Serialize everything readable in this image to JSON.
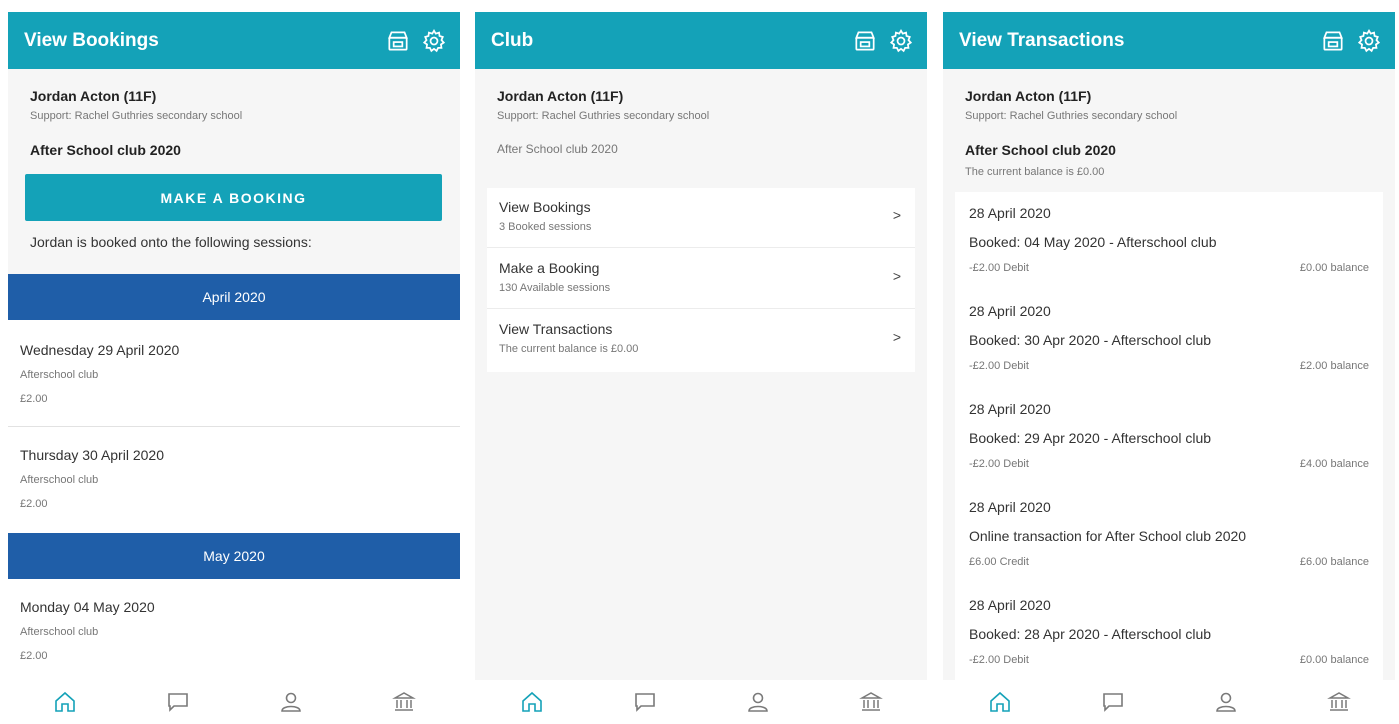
{
  "colors": {
    "header": "#14a2b8",
    "month_bar": "#1f5ea8",
    "button": "#14a2b8",
    "active_tab": "#14a2b8",
    "inactive_tab": "#7a7a7a"
  },
  "student": {
    "name": "Jordan Acton (11F)",
    "support": "Support: Rachel Guthries secondary school"
  },
  "club_name": "After School club 2020",
  "tabs": [
    "home-icon",
    "message-icon",
    "profile-icon",
    "bank-icon"
  ],
  "bookings_screen": {
    "title": "View Bookings",
    "button_label": "MAKE A BOOKING",
    "intro": "Jordan is booked onto the following sessions:",
    "months": [
      {
        "label": "April 2020",
        "sessions": [
          {
            "date": "Wednesday 29 April 2020",
            "name": "Afterschool club",
            "price": "£2.00"
          },
          {
            "date": "Thursday 30 April 2020",
            "name": "Afterschool club",
            "price": "£2.00"
          }
        ]
      },
      {
        "label": "May 2020",
        "sessions": [
          {
            "date": "Monday 04 May 2020",
            "name": "Afterschool club",
            "price": "£2.00"
          }
        ]
      }
    ]
  },
  "club_screen": {
    "title": "Club",
    "menu": [
      {
        "title": "View Bookings",
        "sub": "3 Booked sessions",
        "arrow": ">"
      },
      {
        "title": "Make a Booking",
        "sub": "130 Available sessions",
        "arrow": ">"
      },
      {
        "title": "View Transactions",
        "sub": "The current balance is £0.00",
        "arrow": ">"
      }
    ]
  },
  "transactions_screen": {
    "title": "View Transactions",
    "balance_text": "The current balance is £0.00",
    "transactions": [
      {
        "date": "28 April 2020",
        "desc": "Booked: 04 May 2020 - Afterschool club",
        "amount": "-£2.00 Debit",
        "balance": "£0.00 balance"
      },
      {
        "date": "28 April 2020",
        "desc": "Booked: 30 Apr 2020 - Afterschool club",
        "amount": "-£2.00 Debit",
        "balance": "£2.00 balance"
      },
      {
        "date": "28 April 2020",
        "desc": "Booked: 29 Apr 2020 - Afterschool club",
        "amount": "-£2.00 Debit",
        "balance": "£4.00 balance"
      },
      {
        "date": "28 April 2020",
        "desc": "Online transaction for After School club 2020",
        "amount": "£6.00 Credit",
        "balance": "£6.00 balance"
      },
      {
        "date": "28 April 2020",
        "desc": "Booked: 28 Apr 2020 - Afterschool club",
        "amount": "-£2.00 Debit",
        "balance": "£0.00 balance"
      }
    ]
  }
}
